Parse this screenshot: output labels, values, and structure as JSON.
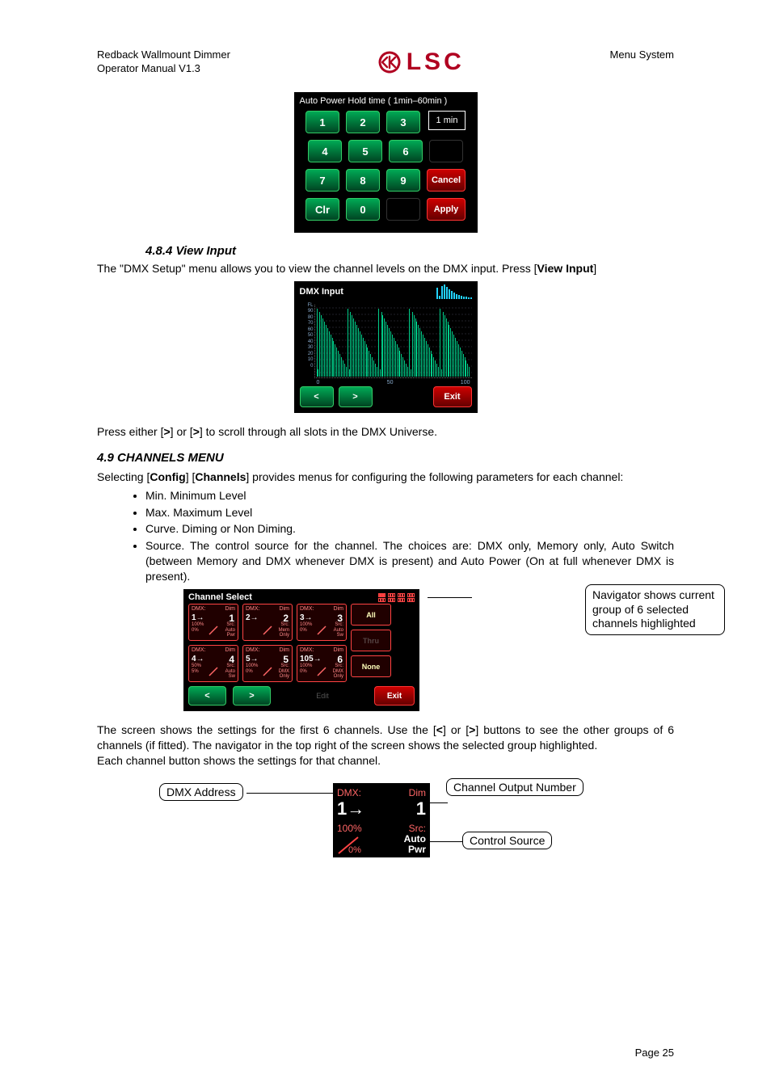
{
  "header": {
    "left_line1": "Redback Wallmount Dimmer",
    "left_line2": "Operator Manual V1.3",
    "right": "Menu System",
    "logo_text": "LSC"
  },
  "keypad": {
    "title": "Auto Power Hold time ( 1min–60min )",
    "value": "1 min",
    "keys": [
      "1",
      "2",
      "3",
      "4",
      "5",
      "6",
      "7",
      "8",
      "9",
      "Clr",
      "0"
    ],
    "cancel": "Cancel",
    "apply": "Apply"
  },
  "sec484": {
    "heading": "4.8.4 View Input",
    "p1_pre": "The \"DMX Setup\" menu allows you to view the channel levels on the DMX input. Press [",
    "p1_bold": "View Input",
    "p1_post": "]"
  },
  "dmx": {
    "title": "DMX Input",
    "xlabels": [
      "0",
      "50",
      "100"
    ],
    "ylabels": [
      "FL",
      "90",
      "80",
      "70",
      "60",
      "50",
      "40",
      "30",
      "20",
      "10",
      "0"
    ],
    "exit": "Exit"
  },
  "line_scroll": {
    "pre": "Press either [",
    "g1": ">",
    "mid": "] or [",
    "g2": ">",
    "post": "] to scroll through all slots in the DMX Universe."
  },
  "sec49": {
    "heading": "4.9   CHANNELS MENU",
    "p1a": "Selecting [",
    "p1b": "Config",
    "p1c": "] [",
    "p1d": "Channels",
    "p1e": "] provides menus for configuring the following parameters for each channel:",
    "bul1": "Min. Minimum Level",
    "bul2": "Max. Maximum Level",
    "bul3": "Curve. Diming or Non Diming.",
    "bul4": "Source. The control source for the channel. The choices are: DMX only, Memory only, Auto Switch (between Memory and DMX whenever DMX is present) and Auto Power (On at full whenever DMX is present)."
  },
  "chsel": {
    "title": "Channel Select",
    "all": "All",
    "thru": "Thru",
    "none": "None",
    "edit": "Edit",
    "exit": "Exit",
    "callout": "Navigator shows current group of 6 selected channels highlighted",
    "cells": [
      {
        "addr": "1→",
        "num": "1",
        "dmx": "DMX:",
        "dim": "Dim",
        "max": "100%",
        "min": "0%",
        "src": "Src:\nAuto\nPwr"
      },
      {
        "addr": "2→",
        "num": "2",
        "dmx": "DMX:",
        "dim": "Dim",
        "max": "",
        "min": "",
        "src": "Src:\nMem\nOnly"
      },
      {
        "addr": "3→",
        "num": "3",
        "dmx": "DMX:",
        "dim": "Dim",
        "max": "100%",
        "min": "0%",
        "src": "Src:\nAuto\nSw"
      },
      {
        "addr": "4→",
        "num": "4",
        "dmx": "DMX:",
        "dim": "Dim",
        "max": "50%",
        "min": "5%",
        "src": "Src:\nAuto\nSw"
      },
      {
        "addr": "5→",
        "num": "5",
        "dmx": "DMX:",
        "dim": "Dim",
        "max": "100%",
        "min": "0%",
        "src": "Src:\nDMX\nOnly"
      },
      {
        "addr": "105→",
        "num": "6",
        "dmx": "DMX:",
        "dim": "Dim",
        "max": "100%",
        "min": "0%",
        "src": "Src:\nDMX\nOnly"
      }
    ]
  },
  "p_after_ch_1": "The screen shows the settings for the first 6 channels. Use the [",
  "p_after_ch_lt": "<",
  "p_after_ch_2": "] or [",
  "p_after_ch_gt": ">",
  "p_after_ch_3": "] buttons to see the other groups of 6 channels (if fitted). The navigator in the top right of the screen shows the selected group highlighted.",
  "p_after_ch_4": "Each channel button shows the settings for that channel.",
  "detail": {
    "c_dmx_addr": "DMX Address",
    "c_out_num": "Channel Output Number",
    "c_control": "Control Source",
    "cell": {
      "dmx": "DMX:",
      "dim": "Dim",
      "addr": "1→",
      "num": "1",
      "max": "100%",
      "min": "0%",
      "srcLbl": "Src:",
      "src1": "Auto",
      "src2": "Pwr"
    }
  },
  "footer": "Page 25"
}
